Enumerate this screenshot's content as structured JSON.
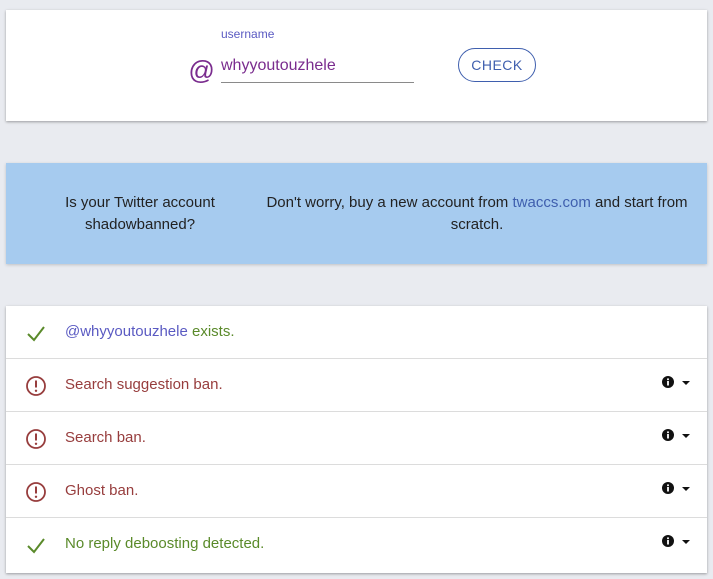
{
  "search": {
    "label": "username",
    "at_symbol": "@",
    "username_value": "whyyoutouzhele",
    "check_label": "CHECK"
  },
  "ad": {
    "left_text": "Is your Twitter account shadowbanned?",
    "right_prefix": "Don't worry, buy a new account from ",
    "link_text": "twaccs.com",
    "right_suffix": " and start from scratch."
  },
  "results": {
    "exists": {
      "mention": "@whyyoutouzhele",
      "text": " exists.",
      "status": "ok",
      "icon": "check-icon"
    },
    "items": [
      {
        "text": "Search suggestion ban.",
        "status": "banned",
        "icon": "alert-circle-icon"
      },
      {
        "text": "Search ban.",
        "status": "banned",
        "icon": "alert-circle-icon"
      },
      {
        "text": "Ghost ban.",
        "status": "banned",
        "icon": "alert-circle-icon"
      },
      {
        "text": "No reply deboosting detected.",
        "status": "ok",
        "icon": "check-icon"
      }
    ]
  },
  "colors": {
    "accent": "#7a2c8e",
    "link": "#3f5fae",
    "ok": "#5a8a2a",
    "banned": "#973d3d",
    "ad_background": "#a6cbef"
  }
}
